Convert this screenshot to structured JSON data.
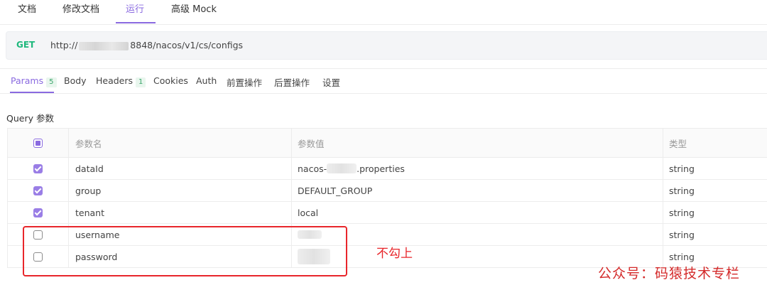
{
  "top_tabs": [
    "文档",
    "修改文档",
    "运行",
    "高级 Mock"
  ],
  "active_top_tab": "运行",
  "request": {
    "method": "GET",
    "url_prefix": "http://",
    "url_suffix": "8848/nacos/v1/cs/configs"
  },
  "request_tabs": [
    {
      "label": "Params",
      "badge": "5"
    },
    {
      "label": "Body"
    },
    {
      "label": "Headers",
      "badge": "1"
    },
    {
      "label": "Cookies"
    },
    {
      "label": "Auth"
    },
    {
      "label": "前置操作"
    },
    {
      "label": "后置操作"
    },
    {
      "label": "设置"
    }
  ],
  "query_label": "Query 参数",
  "table": {
    "headers": [
      "参数名",
      "参数值",
      "类型"
    ],
    "rows": [
      {
        "checked": true,
        "name": "dataId",
        "value_prefix": "nacos-",
        "value_suffix": ".properties",
        "type": "string"
      },
      {
        "checked": true,
        "name": "group",
        "value": "DEFAULT_GROUP",
        "type": "string"
      },
      {
        "checked": true,
        "name": "tenant",
        "value": "local",
        "type": "string"
      },
      {
        "checked": false,
        "name": "username",
        "value": "",
        "type": "string"
      },
      {
        "checked": false,
        "name": "password",
        "value": "",
        "type": "string"
      }
    ]
  },
  "annotation": {
    "note": "不勾上",
    "color": "#e8262b"
  },
  "watermark": "公众号：码猿技术专栏",
  "colors": {
    "accent": "#8a6ae0",
    "get_method": "#1eb87c"
  }
}
